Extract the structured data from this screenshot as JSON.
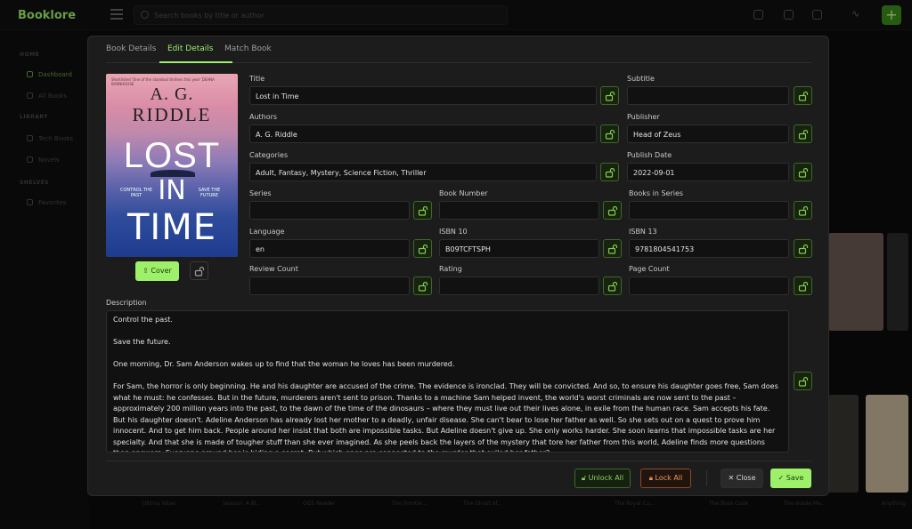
{
  "app": {
    "brand": "Booklore",
    "search_placeholder": "Search books by title or author",
    "sidebar": {
      "sections": [
        "HOME",
        "LIBRARY",
        "SHELVES"
      ],
      "items": [
        "Dashboard",
        "All Books",
        "Tech Books",
        "Novels",
        "Favorites"
      ]
    },
    "bg_titles": [
      "Ultima Vitae",
      "Season: A Bl...",
      "OG5 Reader",
      "The Frontie...",
      "The Ghost of...",
      "The Royal Cu...",
      "The Boss Code",
      "The Inside Ma...",
      "Anything"
    ]
  },
  "modal": {
    "tabs": [
      "Book Details",
      "Edit Details",
      "Match Book"
    ],
    "cover": {
      "tiny": "Shortlisted 'One of the standout thrillers this year' DEANA BARNHOUSE",
      "author_line1": "A. G.",
      "author_line2": "RIDDLE",
      "title_lost": "LOST",
      "title_in": "IN",
      "title_time": "TIME",
      "tag_left": "CONTROL THE PAST",
      "tag_right": "SAVE THE FUTURE",
      "button_label": "Cover"
    },
    "fields": {
      "title": {
        "label": "Title",
        "value": "Lost in Time"
      },
      "subtitle": {
        "label": "Subtitle",
        "value": ""
      },
      "authors": {
        "label": "Authors",
        "value": "A. G. Riddle"
      },
      "publisher": {
        "label": "Publisher",
        "value": "Head of Zeus"
      },
      "categories": {
        "label": "Categories",
        "value": "Adult, Fantasy, Mystery, Science Fiction, Thriller"
      },
      "publish_date": {
        "label": "Publish Date",
        "value": "2022-09-01"
      },
      "series": {
        "label": "Series",
        "value": ""
      },
      "book_number": {
        "label": "Book Number",
        "value": ""
      },
      "books_in_series": {
        "label": "Books in Series",
        "value": ""
      },
      "language": {
        "label": "Language",
        "value": "en"
      },
      "isbn10": {
        "label": "ISBN 10",
        "value": "B09TCFTSPH"
      },
      "isbn13": {
        "label": "ISBN 13",
        "value": "9781804541753"
      },
      "review_count": {
        "label": "Review Count",
        "value": ""
      },
      "rating": {
        "label": "Rating",
        "value": ""
      },
      "page_count": {
        "label": "Page Count",
        "value": ""
      }
    },
    "description": {
      "label": "Description",
      "paragraphs": [
        "Control the past.",
        "Save the future.",
        "One morning, Dr. Sam Anderson wakes up to find that the woman he loves has been murdered.",
        "For Sam, the horror is only beginning. He and his daughter are accused of the crime. The evidence is ironclad. They will be convicted. And so, to ensure his daughter goes free, Sam does what he must: he confesses. But in the future, murderers aren't sent to prison. Thanks to a machine Sam helped invent, the world's worst criminals are now sent to the past – approximately 200 million years into the past, to the dawn of the time of the dinosaurs – where they must live out their lives alone, in exile from the human race. Sam accepts his fate. But his daughter doesn't. Adeline Anderson has already lost her mother to a deadly, unfair disease. She can't bear to lose her father as well. So she sets out on a quest to prove him innocent. And to get him back. People around her insist that both are impossible tasks. But Adeline doesn't give up. She only works harder. She soon learns that impossible tasks are her specialty. And that she is made of tougher stuff than she ever imagined. As she peels back the layers of the mystery that tore her father from this world, Adeline finds more questions than answers. Everyone around her is hiding a secret. But which ones are connected to the murder that exiled her father?"
      ]
    },
    "buttons": {
      "unlock_all": "Unlock All",
      "lock_all": "Lock All",
      "close": "Close",
      "save": "Save"
    }
  },
  "colors": {
    "accent": "#9ef06a",
    "lock_orange": "#f0955a",
    "surface": "#1c1c1c",
    "input_bg": "#111111"
  }
}
